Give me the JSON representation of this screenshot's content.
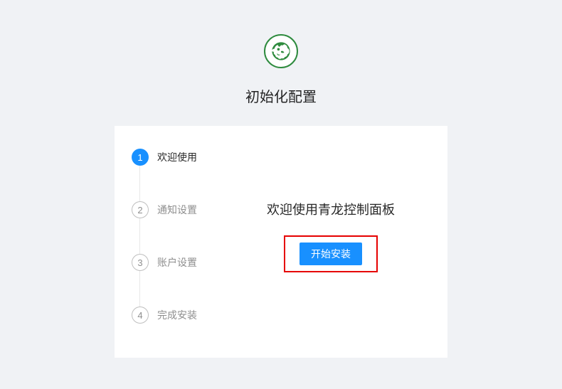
{
  "page_title": "初始化配置",
  "logo": {
    "name": "qinglong-logo"
  },
  "steps": [
    {
      "num": "1",
      "label": "欢迎使用",
      "status": "active"
    },
    {
      "num": "2",
      "label": "通知设置",
      "status": "wait"
    },
    {
      "num": "3",
      "label": "账户设置",
      "status": "wait"
    },
    {
      "num": "4",
      "label": "完成安装",
      "status": "wait"
    }
  ],
  "content": {
    "welcome_title": "欢迎使用青龙控制面板",
    "install_button": "开始安装"
  }
}
